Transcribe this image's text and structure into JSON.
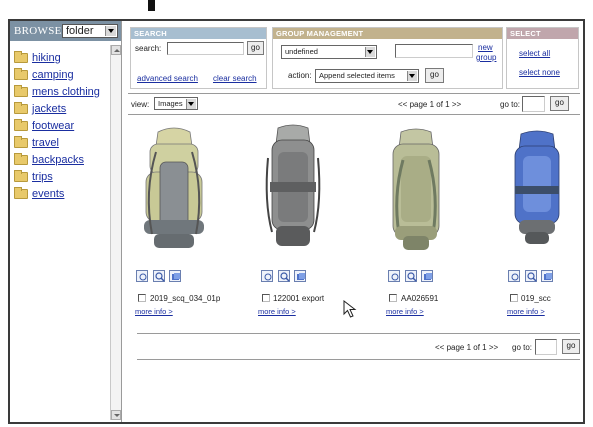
{
  "sidebar": {
    "browse_label": "BROWSE",
    "browse_select": "folder",
    "folders": [
      {
        "label": "hiking"
      },
      {
        "label": "camping"
      },
      {
        "label": "mens clothing"
      },
      {
        "label": "jackets"
      },
      {
        "label": "footwear"
      },
      {
        "label": "travel"
      },
      {
        "label": "backpacks"
      },
      {
        "label": "trips"
      },
      {
        "label": "events"
      }
    ]
  },
  "search": {
    "title": "SEARCH",
    "label": "search:",
    "value": "",
    "go": "go",
    "advanced": "advanced search",
    "clear": "clear search"
  },
  "group": {
    "title": "GROUP MANAGEMENT",
    "group_select": "undefined",
    "new_group_value": "",
    "new_group_link_1": "new",
    "new_group_link_2": "group",
    "action_label": "action:",
    "action_select": "Append selected items",
    "go": "go"
  },
  "select_panel": {
    "title": "SELECT",
    "select_all": "select all",
    "select_none": "select none"
  },
  "toolbar": {
    "view_label": "view:",
    "view_select": "Images",
    "pagination": "<< page 1 of 1 >>",
    "goto_label": "go to:",
    "goto_value": "",
    "go": "go"
  },
  "products": [
    {
      "name": "2019_scq_034_01p",
      "more": "more info >",
      "checked": false
    },
    {
      "name": "122001 export",
      "more": "more info >",
      "checked": false
    },
    {
      "name": "AA026591",
      "more": "more info >",
      "checked": false
    },
    {
      "name": "019_scc",
      "more": "more info >",
      "checked": false
    }
  ],
  "bottom_bar": {
    "pagination": "<< page 1 of 1 >>",
    "goto_label": "go to:",
    "goto_value": "",
    "go": "go"
  },
  "icons": [
    "folder-icon",
    "view-icon",
    "zoom-icon",
    "add-icon",
    "pointer-cursor-icon"
  ],
  "colors": {
    "search_header": "#a7bed0",
    "group_header": "#c2b28d",
    "select_header": "#c0a6ac",
    "browse_header": "#7c91a3",
    "link": "#1a2ea0"
  }
}
